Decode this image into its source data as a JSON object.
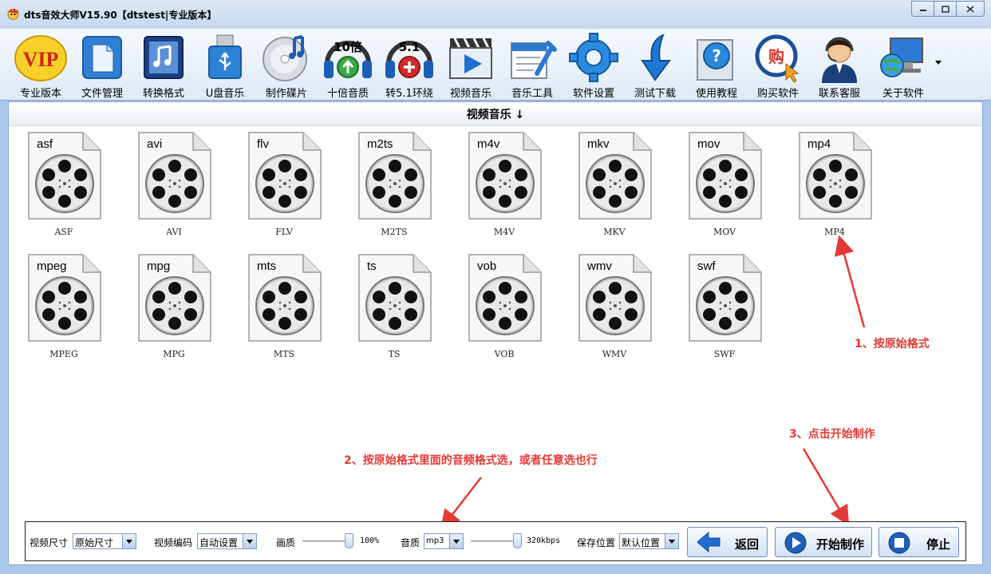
{
  "window": {
    "title": "dts音效大师V15.90【dtstest|专业版本】"
  },
  "toolbar": {
    "items": [
      {
        "label": "专业版本",
        "icon": "vip-icon"
      },
      {
        "label": "文件管理",
        "icon": "file-manage-icon"
      },
      {
        "label": "转换格式",
        "icon": "convert-format-icon"
      },
      {
        "label": "U盘音乐",
        "icon": "usb-music-icon"
      },
      {
        "label": "制作碟片",
        "icon": "disc-icon"
      },
      {
        "label": "十倍音质",
        "icon": "ten-times-quality-icon",
        "badge": "10倍"
      },
      {
        "label": "转5.1环绕",
        "icon": "surround-51-icon",
        "badge": "5.1"
      },
      {
        "label": "视频音乐",
        "icon": "video-music-icon"
      },
      {
        "label": "音乐工具",
        "icon": "music-tools-icon"
      },
      {
        "label": "软件设置",
        "icon": "settings-gear-icon"
      },
      {
        "label": "测试下载",
        "icon": "download-arrow-icon"
      },
      {
        "label": "使用教程",
        "icon": "help-question-icon"
      },
      {
        "label": "购买软件",
        "icon": "buy-icon",
        "badge": "购"
      },
      {
        "label": "联系客服",
        "icon": "customer-service-icon"
      },
      {
        "label": "关于软件",
        "icon": "about-computer-icon"
      }
    ]
  },
  "panel": {
    "title": "视频音乐 ↓"
  },
  "formats": [
    {
      "ext": "asf",
      "name": "ASF"
    },
    {
      "ext": "avi",
      "name": "AVI"
    },
    {
      "ext": "flv",
      "name": "FLV"
    },
    {
      "ext": "m2ts",
      "name": "M2TS"
    },
    {
      "ext": "m4v",
      "name": "M4V"
    },
    {
      "ext": "mkv",
      "name": "MKV"
    },
    {
      "ext": "mov",
      "name": "MOV"
    },
    {
      "ext": "mp4",
      "name": "MP4"
    },
    {
      "ext": "mpeg",
      "name": "MPEG"
    },
    {
      "ext": "mpg",
      "name": "MPG"
    },
    {
      "ext": "mts",
      "name": "MTS"
    },
    {
      "ext": "ts",
      "name": "TS"
    },
    {
      "ext": "vob",
      "name": "VOB"
    },
    {
      "ext": "wmv",
      "name": "WMV"
    },
    {
      "ext": "swf",
      "name": "SWF"
    }
  ],
  "annotations": {
    "a1": "1、按原始格式",
    "a2": "2、按原始格式里面的音频格式选，或者任意选也行",
    "a3": "3、点击开始制作",
    "color": "#e53935"
  },
  "controls": {
    "video_size_label": "视频尺寸",
    "video_size_value": "原始尺寸",
    "video_codec_label": "视频编码",
    "video_codec_value": "自动设置",
    "picture_quality_label": "画质",
    "picture_quality_value": "100%",
    "picture_quality_level": 1.0,
    "audio_quality_label": "音质",
    "audio_format_value": "mp3",
    "audio_bitrate_value": "320kbps",
    "audio_bitrate_level": 1.0,
    "save_location_label": "保存位置",
    "save_location_value": "默认位置",
    "back_label": "返回",
    "start_label": "开始制作",
    "stop_label": "停止"
  }
}
